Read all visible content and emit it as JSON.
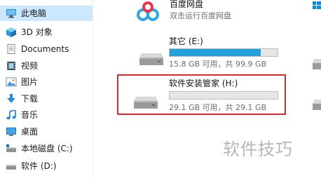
{
  "sidebar": {
    "items": [
      {
        "label": "此电脑",
        "icon": "this-pc-icon",
        "selected": true
      },
      {
        "label": "3D 对象",
        "icon": "3d-objects-icon"
      },
      {
        "label": "Documents",
        "icon": "documents-icon"
      },
      {
        "label": "视频",
        "icon": "videos-icon"
      },
      {
        "label": "图片",
        "icon": "pictures-icon"
      },
      {
        "label": "下载",
        "icon": "downloads-icon"
      },
      {
        "label": "音乐",
        "icon": "music-icon"
      },
      {
        "label": "桌面",
        "icon": "desktop-icon"
      },
      {
        "label": "本地磁盘 (C:)",
        "icon": "drive-icon"
      },
      {
        "label": "软件 (D:)",
        "icon": "drive-icon"
      }
    ]
  },
  "main": {
    "baidu": {
      "name": "百度网盘",
      "subtitle": "双击运行百度网盘",
      "icon": "baidu-netdisk-icon"
    },
    "drives": [
      {
        "name": "其它 (E:)",
        "size_text": "15.8 GB 可用，共 99.9 GB",
        "used_fraction": 0.842,
        "icon": "drive-icon"
      },
      {
        "name": "软件安装管家 (H:)",
        "size_text": "29.1 GB 可用，共 29.1 GB",
        "used_fraction": 0.0,
        "icon": "drive-icon",
        "highlighted": true
      }
    ]
  },
  "watermark": "软件技巧",
  "colors": {
    "selection": "#cce8ff",
    "progress": "#26a0da",
    "highlight": "#d9282e"
  }
}
